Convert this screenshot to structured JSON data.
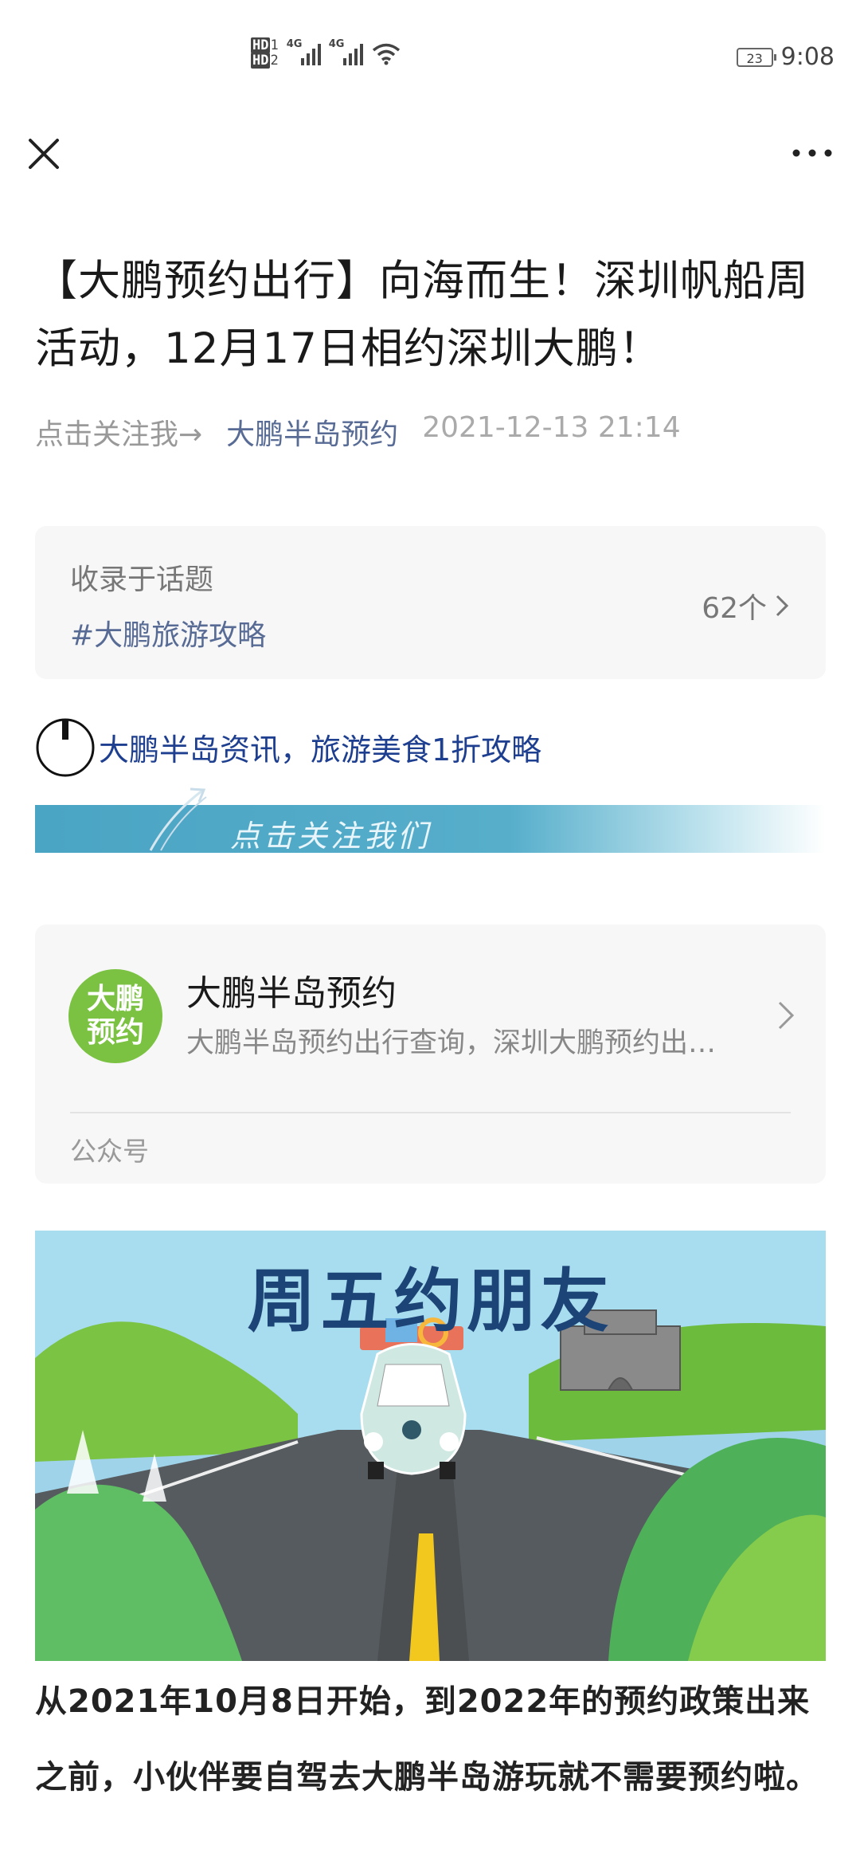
{
  "status_bar": {
    "hd1": "HD",
    "hd1_idx": "1",
    "hd2": "HD",
    "hd2_idx": "2",
    "net1": "4G",
    "net2": "4G",
    "battery": "23",
    "time": "9:08"
  },
  "nav": {
    "close_icon": "close-icon",
    "more_icon": "more-icon"
  },
  "article": {
    "title": "【大鹏预约出行】向海而生！深圳帆船周活动，12月17日相约深圳大鹏！",
    "follow_prompt": "点击关注我→",
    "account": "大鹏半岛预约",
    "date": "2021-12-13 21:14"
  },
  "topic": {
    "label": "收录于话题",
    "tag": "#大鹏旅游攻略",
    "count": "62个"
  },
  "promo": {
    "headline": "大鹏半岛资讯，旅游美食1折攻略",
    "banner_text": "点击关注我们"
  },
  "account_card": {
    "avatar_line1": "大鹏",
    "avatar_line2": "预约",
    "name": "大鹏半岛预约",
    "description": "大鹏半岛预约出行查询，深圳大鹏预约出行查询，深圳大鹏预约",
    "type": "公众号"
  },
  "illustration": {
    "title": "周五约朋友"
  },
  "body_text": "从2021年10月8日开始，到2022年的预约政策出来之前，小伙伴要自驾去大鹏半岛游玩就不需要预约啦。",
  "colors": {
    "link": "#576b95",
    "promo": "#1e3f8f",
    "avatar": "#7bc242"
  }
}
